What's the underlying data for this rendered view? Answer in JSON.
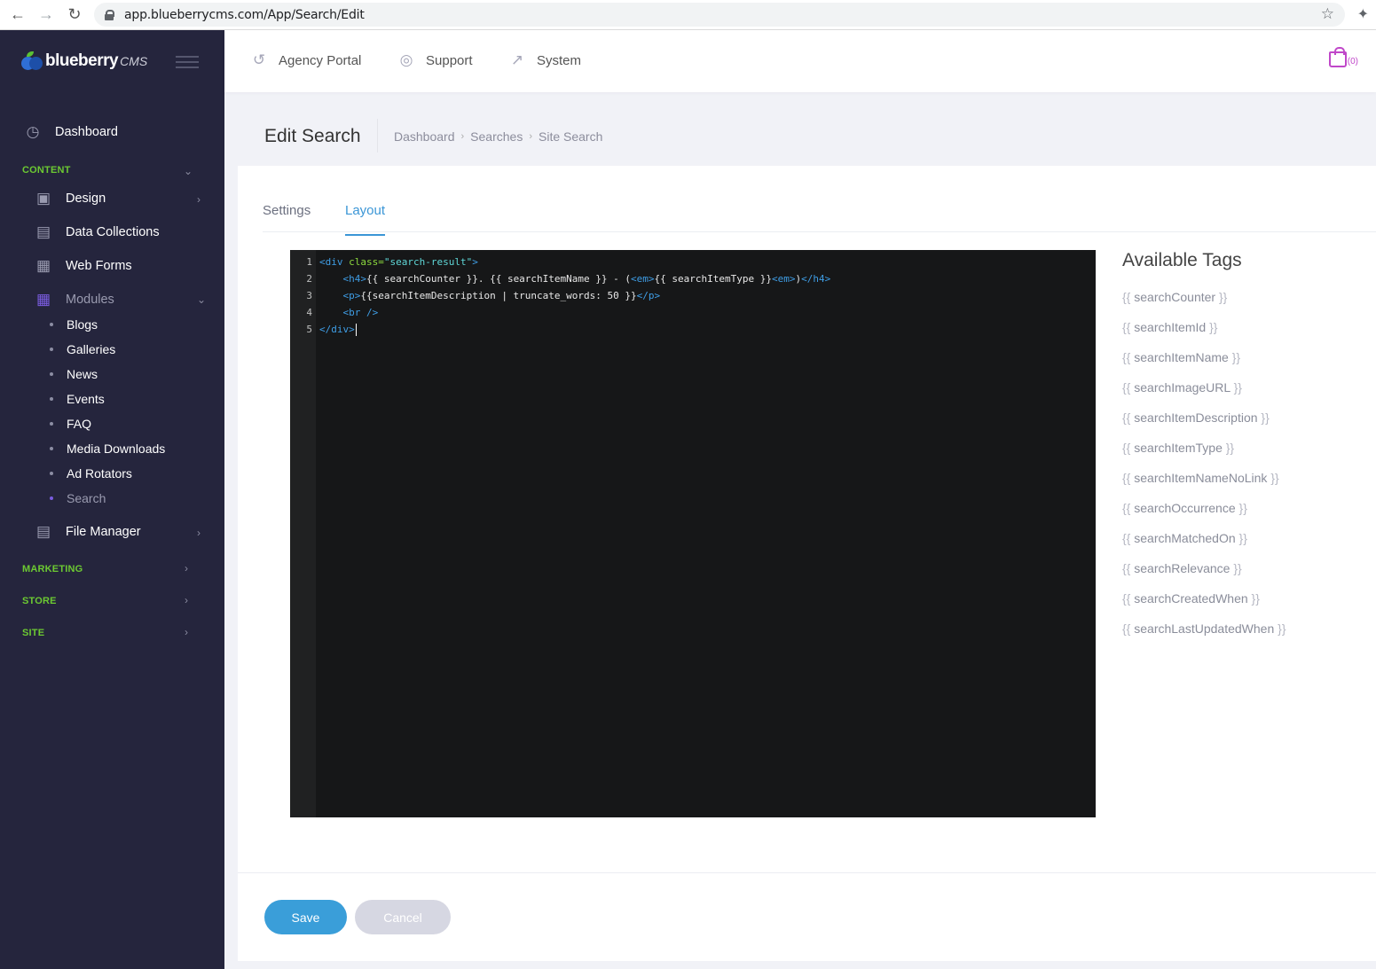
{
  "browser": {
    "url": "app.blueberrycms.com/App/Search/Edit"
  },
  "logo": {
    "name": "blueberry",
    "suffix": "CMS",
    "colors": {
      "berry": "#2f6fd6",
      "leaf": "#5bc234"
    }
  },
  "sidebar": {
    "dashboard": "Dashboard",
    "sections": {
      "content": "CONTENT",
      "marketing": "MARKETING",
      "store": "STORE",
      "site": "SITE"
    },
    "content_items": {
      "design": "Design",
      "data_collections": "Data Collections",
      "web_forms": "Web Forms",
      "modules": "Modules",
      "file_manager": "File Manager"
    },
    "modules": [
      "Blogs",
      "Galleries",
      "News",
      "Events",
      "FAQ",
      "Media Downloads",
      "Ad Rotators",
      "Search"
    ],
    "active_module": "Search"
  },
  "topbar": {
    "agency_portal": "Agency Portal",
    "support": "Support",
    "system": "System",
    "cart_count": "(0)"
  },
  "page": {
    "title": "Edit Search",
    "breadcrumb": [
      "Dashboard",
      "Searches",
      "Site Search"
    ]
  },
  "tabs": {
    "settings": "Settings",
    "layout": "Layout",
    "active": "Layout"
  },
  "editor": {
    "line_numbers": [
      "1",
      "2",
      "3",
      "4",
      "5"
    ],
    "l1": {
      "open": "<div ",
      "attr": "class=",
      "val": "\"search-result\"",
      "close": ">"
    },
    "l2": {
      "indent": "    ",
      "h4o": "<h4>",
      "t1": "{{ searchCounter }}. {{ searchItemName }} - (",
      "emo": "<em>",
      "t2": "{{ searchItemType }}",
      "emc": "<em>",
      "t3": ")",
      "h4c": "</h4>"
    },
    "l3": {
      "indent": "    ",
      "po": "<p>",
      "t1": "{{searchItemDescription | truncate_words: 50 }}",
      "pc": "</p>"
    },
    "l4": {
      "indent": "    ",
      "br": "<br />"
    },
    "l5": {
      "divc": "</div>"
    }
  },
  "available_tags": {
    "title": "Available Tags",
    "open": "{{",
    "close": "}}",
    "items": [
      "searchCounter",
      "searchItemId",
      "searchItemName",
      "searchImageURL",
      "searchItemDescription",
      "searchItemType",
      "searchItemNameNoLink",
      "searchOccurrence",
      "searchMatchedOn",
      "searchRelevance",
      "searchCreatedWhen",
      "searchLastUpdatedWhen"
    ]
  },
  "buttons": {
    "save": "Save",
    "cancel": "Cancel"
  },
  "colors": {
    "accent": "#3a9ed9",
    "section_green": "#6cc932",
    "sidebar_bg": "#25253d",
    "cart": "#c047c9"
  }
}
